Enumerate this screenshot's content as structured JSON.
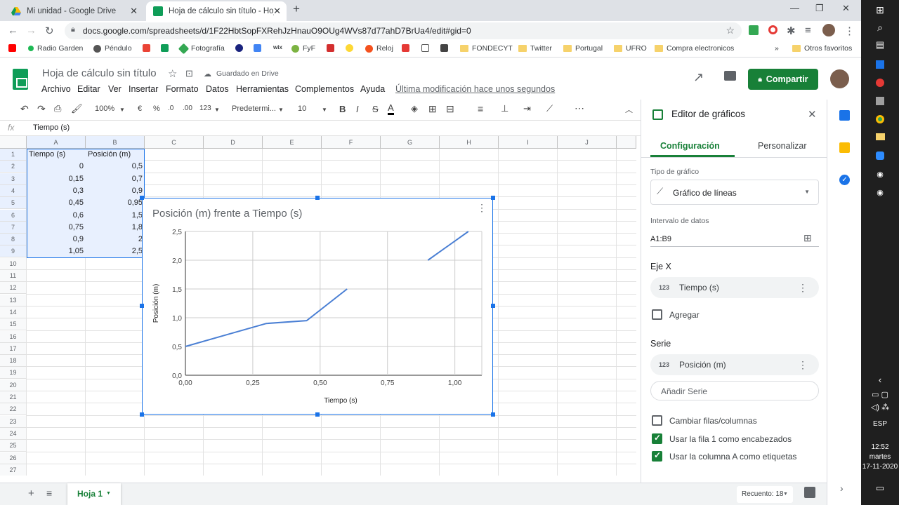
{
  "browser": {
    "tabs": [
      {
        "title": "Mi unidad - Google Drive"
      },
      {
        "title": "Hoja de cálculo sin título - Hojas"
      }
    ],
    "url": "docs.google.com/spreadsheets/d/1F22HbtSopFXRehJzHnauO9OUg4WVs87d77ahD7BrUa4/edit#gid=0",
    "bookmarks": [
      "Radio Garden",
      "Péndulo",
      "Fotografía",
      "FyF",
      "Reloj",
      "FONDECYT",
      "Twitter",
      "Portugal",
      "UFRO",
      "Compra electronicos",
      "Otros favoritos"
    ]
  },
  "sheets": {
    "title": "Hoja de cálculo sin título",
    "saved_status": "Guardado en Drive",
    "menus": [
      "Archivo",
      "Editar",
      "Ver",
      "Insertar",
      "Formato",
      "Datos",
      "Herramientas",
      "Complementos",
      "Ayuda"
    ],
    "last_edit": "Última modificación hace unos segundos",
    "share_label": "Compartir",
    "toolbar": {
      "zoom": "100%",
      "currency": "€",
      "percent": "%",
      "dec_less": ".0",
      "dec_more": ".00",
      "format_more": "123",
      "font": "Predetermi...",
      "font_size": "10"
    },
    "formula_value": "Tiempo (s)",
    "columns": [
      "A",
      "B",
      "C",
      "D",
      "E",
      "F",
      "G",
      "H",
      "I",
      "J"
    ],
    "rows": [
      "1",
      "2",
      "3",
      "4",
      "5",
      "6",
      "7",
      "8",
      "9",
      "10",
      "11",
      "12",
      "13",
      "14",
      "15",
      "16",
      "17",
      "18",
      "19",
      "20",
      "21",
      "22",
      "23",
      "24",
      "25",
      "26",
      "27"
    ],
    "headers": [
      "Tiempo (s)",
      "Posición (m)"
    ],
    "data_a": [
      "0",
      "0,15",
      "0,3",
      "0,45",
      "0,6",
      "0,75",
      "0,9",
      "1,05"
    ],
    "data_b": [
      "0,5",
      "0,7",
      "0,9",
      "0,95",
      "1,5",
      "1,8",
      "2",
      "2,5"
    ],
    "sheet_tab": "Hoja 1",
    "status_count": "Recuento: 18"
  },
  "chart_data": {
    "type": "line",
    "title": "Posición (m) frente a Tiempo (s)",
    "xlabel": "Tiempo (s)",
    "ylabel": "Posición (m)",
    "x": [
      0,
      0.15,
      0.3,
      0.45,
      0.6,
      0.75,
      0.9,
      1.05
    ],
    "series": [
      {
        "values": [
          0.5,
          0.7,
          0.9,
          0.95,
          1.5,
          null,
          2.0,
          2.5
        ]
      }
    ],
    "xlim": [
      0,
      1.1
    ],
    "ylim": [
      0,
      2.5
    ],
    "x_ticks": [
      "0,00",
      "0,25",
      "0,50",
      "0,75",
      "1,00"
    ],
    "y_ticks": [
      "0,0",
      "0,5",
      "1,0",
      "1,5",
      "2,0",
      "2,5"
    ],
    "x_tick_values": [
      0,
      0.25,
      0.5,
      0.75,
      1.0
    ],
    "y_tick_values": [
      0,
      0.5,
      1.0,
      1.5,
      2.0,
      2.5
    ],
    "grid": true,
    "line_color": "#4a7fd4"
  },
  "editor": {
    "title": "Editor de gráficos",
    "tab_config": "Configuración",
    "tab_custom": "Personalizar",
    "chart_type_label": "Tipo de gráfico",
    "chart_type_value": "Gráfico de líneas",
    "data_range_label": "Intervalo de datos",
    "data_range_value": "A1:B9",
    "x_axis_label": "Eje X",
    "x_axis_value": "Tiempo (s)",
    "add_label": "Agregar",
    "series_label": "Serie",
    "series_value": "Posición (m)",
    "add_series": "Añadir Serie",
    "switch_rows": "Cambiar filas/columnas",
    "use_row1": "Usar la fila 1 como encabezados",
    "use_colA": "Usar la columna A como etiquetas",
    "num_icon": "123"
  },
  "taskbar": {
    "lang": "ESP",
    "time": "12:52",
    "day": "martes",
    "date": "17-11-2020"
  },
  "colors": {
    "accent": "#1a73e8",
    "share": "#188038",
    "sheets_green": "#0f9d58"
  }
}
